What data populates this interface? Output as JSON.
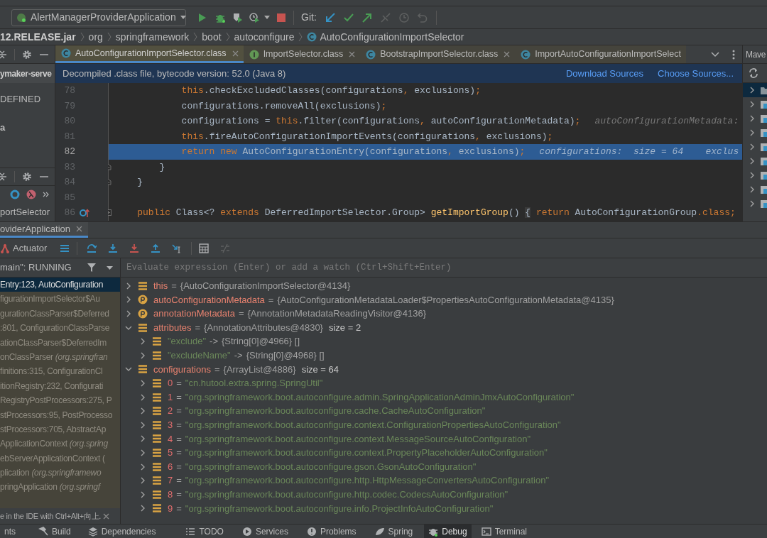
{
  "toolbar": {
    "run_config": "AlertManagerProviderApplication",
    "git_label": "Git:"
  },
  "breadcrumb": [
    {
      "label": "12.RELEASE.jar",
      "kind": "jar"
    },
    {
      "label": "org",
      "kind": "package"
    },
    {
      "label": "springframework",
      "kind": "package"
    },
    {
      "label": "boot",
      "kind": "package"
    },
    {
      "label": "autoconfigure",
      "kind": "package"
    },
    {
      "label": "AutoConfigurationImportSelector",
      "kind": "class"
    }
  ],
  "project_panel": {
    "title": "ymaker-serve",
    "items": [
      "DEFINED",
      "a"
    ]
  },
  "structure_panel": {
    "item": "portSelector"
  },
  "editor_tabs": [
    {
      "label": "AutoConfigurationImportSelector.class",
      "kind": "class",
      "selected": true,
      "closable": true
    },
    {
      "label": "ImportSelector.class",
      "kind": "interface",
      "selected": false,
      "closable": true
    },
    {
      "label": "BootstrapImportSelector.class",
      "kind": "class",
      "selected": false,
      "closable": true
    },
    {
      "label": "ImportAutoConfigurationImportSelect",
      "kind": "class",
      "selected": false,
      "closable": false
    }
  ],
  "maven_panel": {
    "title": "Mave"
  },
  "banner": {
    "text": "Decompiled .class file, bytecode version: 52.0 (Java 8)",
    "links": [
      "Download Sources",
      "Choose Sources..."
    ]
  },
  "code_lines": [
    {
      "number": "78",
      "current": false,
      "segments": [
        {
          "kind": "keyword",
          "text": "            this"
        },
        {
          "kind": "plain",
          "text": ".checkExcludedClasses(configurations"
        },
        {
          "kind": "punct",
          "text": ","
        },
        {
          "kind": "plain",
          "text": " exclusions)"
        },
        {
          "kind": "punct",
          "text": ";"
        }
      ]
    },
    {
      "number": "79",
      "current": false,
      "segments": [
        {
          "kind": "plain",
          "text": "            configurations.removeAll(exclusions)"
        },
        {
          "kind": "punct",
          "text": ";"
        }
      ]
    },
    {
      "number": "80",
      "current": false,
      "segments": [
        {
          "kind": "plain",
          "text": "            configurations = "
        },
        {
          "kind": "keyword",
          "text": "this"
        },
        {
          "kind": "plain",
          "text": ".filter(configurations"
        },
        {
          "kind": "punct",
          "text": ","
        },
        {
          "kind": "plain",
          "text": " autoConfigurationMetadata)"
        },
        {
          "kind": "punct",
          "text": ";"
        }
      ],
      "hint": "autoConfigurationMetadata:"
    },
    {
      "number": "81",
      "current": false,
      "segments": [
        {
          "kind": "keyword",
          "text": "            this"
        },
        {
          "kind": "plain",
          "text": ".fireAutoConfigurationImportEvents(configurations"
        },
        {
          "kind": "punct",
          "text": ","
        },
        {
          "kind": "plain",
          "text": " exclusions)"
        },
        {
          "kind": "punct",
          "text": ";"
        }
      ]
    },
    {
      "number": "82",
      "current": true,
      "segments": [
        {
          "kind": "keyword",
          "text": "            return new"
        },
        {
          "kind": "plain",
          "text": " AutoConfigurationEntry(configurations"
        },
        {
          "kind": "punct",
          "text": ","
        },
        {
          "kind": "plain",
          "text": " exclusions)"
        },
        {
          "kind": "punct",
          "text": ";"
        }
      ],
      "hint": "configurations:  size = 64    exclus"
    },
    {
      "number": "83",
      "current": false,
      "fold_end": true,
      "segments": [
        {
          "kind": "plain",
          "text": "        }"
        }
      ]
    },
    {
      "number": "84",
      "current": false,
      "fold_end": true,
      "segments": [
        {
          "kind": "plain",
          "text": "    }"
        }
      ]
    },
    {
      "number": "85",
      "current": false
    },
    {
      "number": "86",
      "current": false,
      "folded": true,
      "overrides": true,
      "segments": [
        {
          "kind": "keyword",
          "text": "    public"
        },
        {
          "kind": "plain",
          "text": " Class<? "
        },
        {
          "kind": "keyword",
          "text": "extends"
        },
        {
          "kind": "plain",
          "text": " DeferredImportSelector.Group> "
        },
        {
          "kind": "method",
          "text": "getImportGroup"
        },
        {
          "kind": "plain",
          "text": "() "
        },
        {
          "kind": "folded",
          "text": "{"
        },
        {
          "kind": "keyword",
          "text": " return"
        },
        {
          "kind": "plain",
          "text": " AutoConfigurationGroup"
        },
        {
          "kind": "keyword",
          "text": ".class;"
        }
      ]
    }
  ],
  "debug_tab": {
    "title": "oviderApplication",
    "selected": true
  },
  "debug_toolbar": {
    "actuator": "Actuator"
  },
  "thread": "main\": RUNNING",
  "evaluate": {
    "placeholder": "Evaluate expression (Enter) or add a watch (Ctrl+Shift+Enter)"
  },
  "frames": [
    {
      "text": "Entry:123, AutoConfiguration",
      "selected": true
    },
    {
      "text": "figurationImportSelector$Au",
      "selected": false
    },
    {
      "text": "gurationClassParser$Deferred",
      "selected": false
    },
    {
      "text": ":801, ConfigurationClassParse",
      "selected": false
    },
    {
      "text": "ationClassParser$DeferredIm",
      "selected": false
    },
    {
      "text": "onClassParser *(org.springfran*",
      "selected": false
    },
    {
      "text": "finitions:315, ConfigurationCl",
      "selected": false
    },
    {
      "text": "itionRegistry:232, Configurati",
      "selected": false
    },
    {
      "text": "RegistryPostProcessors:275, P",
      "selected": false
    },
    {
      "text": "stProcessors:95, PostProcesso",
      "selected": false
    },
    {
      "text": "stProcessors:705, AbstractAp",
      "selected": false
    },
    {
      "text": "ApplicationContext *(org.spring*",
      "selected": false
    },
    {
      "text": "ebServerApplicationContext (",
      "selected": false
    },
    {
      "text": "plication *(org.springframewo*",
      "selected": false
    },
    {
      "text": "pringApplication *(org.springf*",
      "selected": false
    }
  ],
  "hint": "e in the IDE with Ctrl+Alt+向上.",
  "variables": [
    {
      "kind": "variable",
      "name": "this",
      "separator": "=",
      "value": "{AutoConfigurationImportSelector@4134}",
      "expanded": false
    },
    {
      "kind": "parameter",
      "name": "autoConfigurationMetadata",
      "separator": "=",
      "value": "{AutoConfigurationMetadataLoader$PropertiesAutoConfigurationMetadata@4135}",
      "expanded": false
    },
    {
      "kind": "parameter",
      "name": "annotationMetadata",
      "separator": "=",
      "value": "{AnnotationMetadataReadingVisitor@4136}",
      "expanded": false
    },
    {
      "kind": "variable",
      "name": "attributes",
      "separator": "=",
      "value": "{AnnotationAttributes@4830}",
      "size": "size = 2",
      "expanded": true,
      "children": [
        {
          "kind": "map_entry",
          "name": "\"exclude\"",
          "separator": "->",
          "value": "{String[0]@4966} []",
          "expanded": false
        },
        {
          "kind": "map_entry",
          "name": "\"excludeName\"",
          "separator": "->",
          "value": "{String[0]@4968} []",
          "expanded": false
        }
      ]
    },
    {
      "kind": "variable",
      "name": "configurations",
      "separator": "=",
      "value": "{ArrayList@4886}",
      "size": "size = 64",
      "expanded": true,
      "children": [
        {
          "kind": "element",
          "name": "0",
          "separator": "=",
          "value": "\"cn.hutool.extra.spring.SpringUtil\"",
          "expanded": false
        },
        {
          "kind": "element",
          "name": "1",
          "separator": "=",
          "value": "\"org.springframework.boot.autoconfigure.admin.SpringApplicationAdminJmxAutoConfiguration\"",
          "expanded": false
        },
        {
          "kind": "element",
          "name": "2",
          "separator": "=",
          "value": "\"org.springframework.boot.autoconfigure.cache.CacheAutoConfiguration\"",
          "expanded": false
        },
        {
          "kind": "element",
          "name": "3",
          "separator": "=",
          "value": "\"org.springframework.boot.autoconfigure.context.ConfigurationPropertiesAutoConfiguration\"",
          "expanded": false
        },
        {
          "kind": "element",
          "name": "4",
          "separator": "=",
          "value": "\"org.springframework.boot.autoconfigure.context.MessageSourceAutoConfiguration\"",
          "expanded": false
        },
        {
          "kind": "element",
          "name": "5",
          "separator": "=",
          "value": "\"org.springframework.boot.autoconfigure.context.PropertyPlaceholderAutoConfiguration\"",
          "expanded": false
        },
        {
          "kind": "element",
          "name": "6",
          "separator": "=",
          "value": "\"org.springframework.boot.autoconfigure.gson.GsonAutoConfiguration\"",
          "expanded": false
        },
        {
          "kind": "element",
          "name": "7",
          "separator": "=",
          "value": "\"org.springframework.boot.autoconfigure.http.HttpMessageConvertersAutoConfiguration\"",
          "expanded": false
        },
        {
          "kind": "element",
          "name": "8",
          "separator": "=",
          "value": "\"org.springframework.boot.autoconfigure.http.codec.CodecsAutoConfiguration\"",
          "expanded": false
        },
        {
          "kind": "element",
          "name": "9",
          "separator": "=",
          "value": "\"org.springframework.boot.autoconfigure.info.ProjectInfoAutoConfiguration\"",
          "expanded": false
        }
      ]
    }
  ],
  "bottom_tabs": [
    {
      "label": "nts",
      "selected": false
    },
    {
      "label": "Build",
      "selected": false
    },
    {
      "label": "Dependencies",
      "selected": false
    },
    {
      "label": "TODO",
      "selected": false
    },
    {
      "label": "Services",
      "selected": false
    },
    {
      "label": "Problems",
      "selected": false
    },
    {
      "label": "Spring",
      "selected": false
    },
    {
      "label": "Debug",
      "selected": true
    },
    {
      "label": "Terminal",
      "selected": false
    }
  ]
}
